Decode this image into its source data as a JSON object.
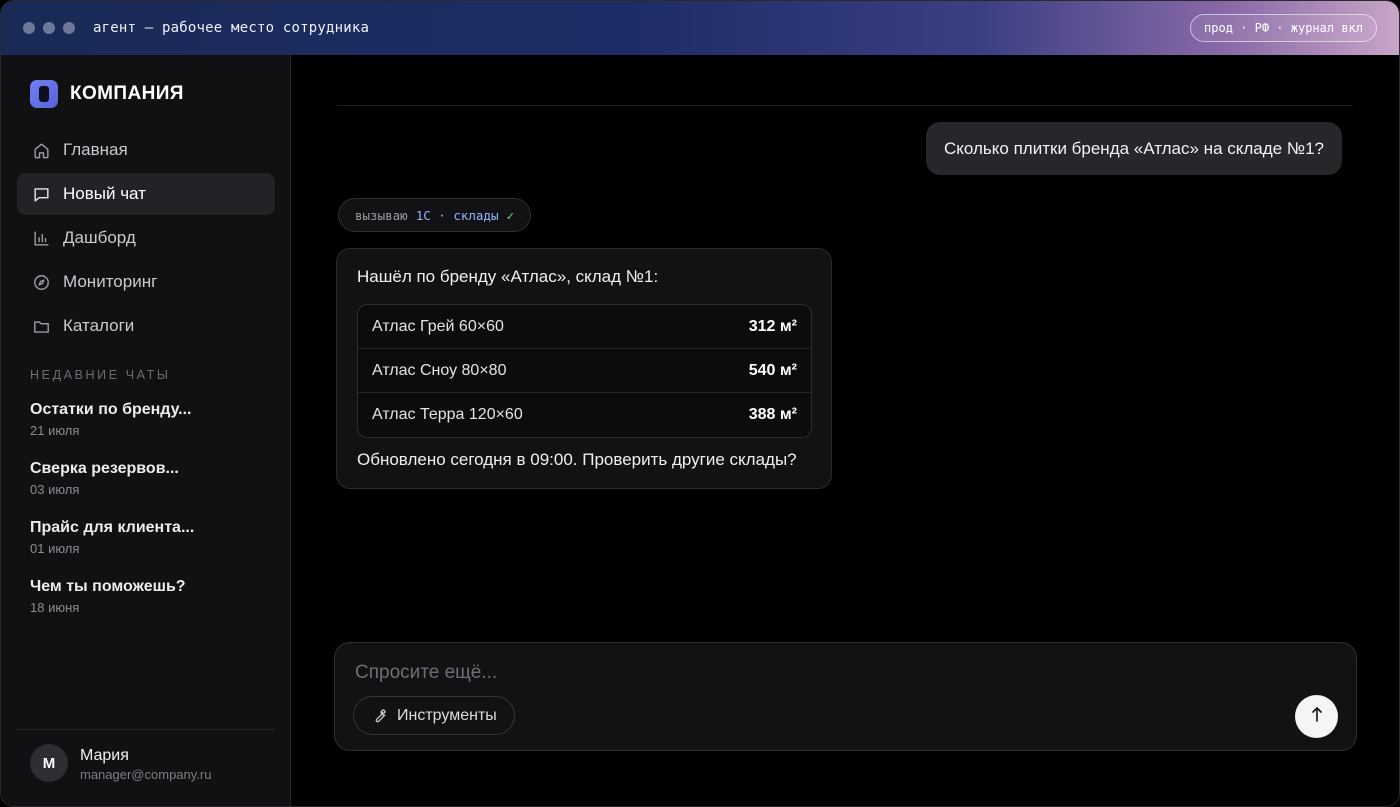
{
  "window": {
    "title": "агент — рабочее место сотрудника",
    "env_badge": "прод · РФ · журнал вкл"
  },
  "sidebar": {
    "brand": "КОМПАНИЯ",
    "nav": [
      {
        "label": "Главная",
        "icon": "home-icon",
        "active": false
      },
      {
        "label": "Новый чат",
        "icon": "chat-icon",
        "active": true
      },
      {
        "label": "Дашборд",
        "icon": "bar-chart-icon",
        "active": false
      },
      {
        "label": "Мониторинг",
        "icon": "compass-icon",
        "active": false
      },
      {
        "label": "Каталоги",
        "icon": "folder-icon",
        "active": false
      }
    ],
    "recent_title": "НЕДАВНИЕ ЧАТЫ",
    "recent": [
      {
        "name": "Остатки по бренду...",
        "date": "21 июля"
      },
      {
        "name": "Сверка резервов...",
        "date": "03 июля"
      },
      {
        "name": "Прайс для клиента...",
        "date": "01 июля"
      },
      {
        "name": "Чем ты поможешь?",
        "date": "18 июня"
      }
    ],
    "user": {
      "initial": "М",
      "name": "Мария",
      "email": "manager@company.ru"
    }
  },
  "chat": {
    "user_message": "Сколько плитки бренда «Атлас» на складе №1?",
    "tool_call": {
      "verb": "вызываю",
      "target": "1С · склады",
      "status": "✓"
    },
    "answer": {
      "intro": "Нашёл по бренду «Атлас», склад №1:",
      "rows": [
        {
          "name": "Атлас Грей 60×60",
          "qty": "312 м²"
        },
        {
          "name": "Атлас Сноу 80×80",
          "qty": "540 м²"
        },
        {
          "name": "Атлас Терра 120×60",
          "qty": "388 м²"
        }
      ],
      "outro": "Обновлено сегодня в 09:00. Проверить другие склады?"
    }
  },
  "composer": {
    "placeholder": "Спросите ещё...",
    "value": "",
    "tools_label": "Инструменты",
    "send_icon": "arrow-up-icon"
  },
  "colors": {
    "accent": "#6f7ff5",
    "tool_target": "#8fb4ff",
    "success": "#6fd68a"
  }
}
